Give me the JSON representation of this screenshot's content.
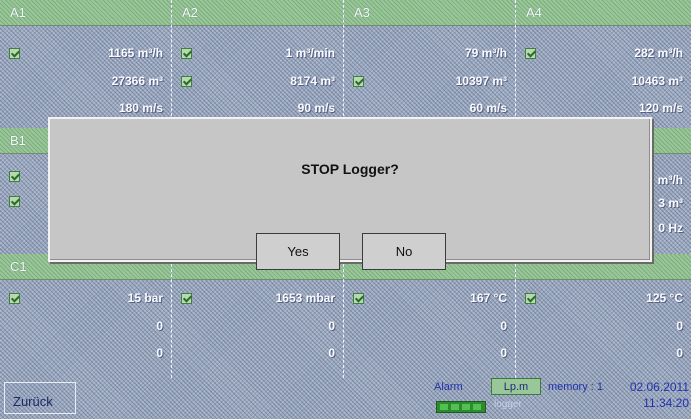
{
  "rowA": {
    "cols": [
      {
        "header": "A1",
        "line1": "1165  m³/h",
        "line2": "27366  m³",
        "line3": "180  m/s"
      },
      {
        "header": "A2",
        "line1": "1  m³/min",
        "line2": "8174  m³",
        "line3": "90  m/s"
      },
      {
        "header": "A3",
        "line1": "79  m³/h",
        "line2": "10397  m³",
        "line3": "60  m/s"
      },
      {
        "header": "A4",
        "line1": "282  m³/h",
        "line2": "10463  m³",
        "line3": "120  m/s"
      }
    ]
  },
  "rowB": {
    "cols": [
      {
        "header": "B1"
      },
      {
        "header": ""
      },
      {
        "header": ""
      },
      {
        "header": "",
        "line1": "m³/h",
        "line2": "3  m³",
        "line3": "0  Hz"
      }
    ]
  },
  "rowC": {
    "cols": [
      {
        "header": "C1",
        "line1": "15  bar",
        "line2": "0",
        "line3": "0"
      },
      {
        "header": "",
        "line1": "1653  mbar",
        "line2": "0",
        "line3": "0"
      },
      {
        "header": "",
        "line1": "167  °C",
        "line2": "0",
        "line3": "0"
      },
      {
        "header": "",
        "line1": "125  °C",
        "line2": "0",
        "line3": "0"
      }
    ]
  },
  "dialog": {
    "title": "STOP Logger?",
    "yes_label": "Yes",
    "no_label": "No"
  },
  "footer": {
    "back_label": "Zurück",
    "alarm_label": "Alarm",
    "lpm_label": "Lp.m",
    "memory_label": "memory : 1",
    "logger_label": "logger",
    "date": "02.06.2011",
    "time": "11:34:20"
  },
  "colors": {
    "header_green": "#9ac79a",
    "value_text": "#fbfbff",
    "dialog_bg": "#c6c6c6",
    "status_blue": "#2233aa"
  }
}
